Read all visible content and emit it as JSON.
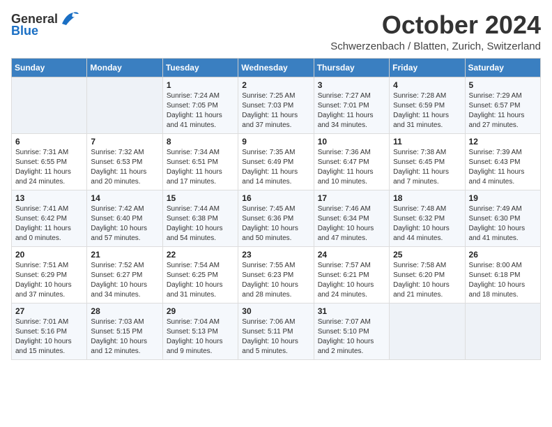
{
  "header": {
    "logo_general": "General",
    "logo_blue": "Blue",
    "month_title": "October 2024",
    "subtitle": "Schwerzenbach / Blatten, Zurich, Switzerland"
  },
  "days_of_week": [
    "Sunday",
    "Monday",
    "Tuesday",
    "Wednesday",
    "Thursday",
    "Friday",
    "Saturday"
  ],
  "weeks": [
    [
      {
        "day": "",
        "info": ""
      },
      {
        "day": "",
        "info": ""
      },
      {
        "day": "1",
        "info": "Sunrise: 7:24 AM\nSunset: 7:05 PM\nDaylight: 11 hours and 41 minutes."
      },
      {
        "day": "2",
        "info": "Sunrise: 7:25 AM\nSunset: 7:03 PM\nDaylight: 11 hours and 37 minutes."
      },
      {
        "day": "3",
        "info": "Sunrise: 7:27 AM\nSunset: 7:01 PM\nDaylight: 11 hours and 34 minutes."
      },
      {
        "day": "4",
        "info": "Sunrise: 7:28 AM\nSunset: 6:59 PM\nDaylight: 11 hours and 31 minutes."
      },
      {
        "day": "5",
        "info": "Sunrise: 7:29 AM\nSunset: 6:57 PM\nDaylight: 11 hours and 27 minutes."
      }
    ],
    [
      {
        "day": "6",
        "info": "Sunrise: 7:31 AM\nSunset: 6:55 PM\nDaylight: 11 hours and 24 minutes."
      },
      {
        "day": "7",
        "info": "Sunrise: 7:32 AM\nSunset: 6:53 PM\nDaylight: 11 hours and 20 minutes."
      },
      {
        "day": "8",
        "info": "Sunrise: 7:34 AM\nSunset: 6:51 PM\nDaylight: 11 hours and 17 minutes."
      },
      {
        "day": "9",
        "info": "Sunrise: 7:35 AM\nSunset: 6:49 PM\nDaylight: 11 hours and 14 minutes."
      },
      {
        "day": "10",
        "info": "Sunrise: 7:36 AM\nSunset: 6:47 PM\nDaylight: 11 hours and 10 minutes."
      },
      {
        "day": "11",
        "info": "Sunrise: 7:38 AM\nSunset: 6:45 PM\nDaylight: 11 hours and 7 minutes."
      },
      {
        "day": "12",
        "info": "Sunrise: 7:39 AM\nSunset: 6:43 PM\nDaylight: 11 hours and 4 minutes."
      }
    ],
    [
      {
        "day": "13",
        "info": "Sunrise: 7:41 AM\nSunset: 6:42 PM\nDaylight: 11 hours and 0 minutes."
      },
      {
        "day": "14",
        "info": "Sunrise: 7:42 AM\nSunset: 6:40 PM\nDaylight: 10 hours and 57 minutes."
      },
      {
        "day": "15",
        "info": "Sunrise: 7:44 AM\nSunset: 6:38 PM\nDaylight: 10 hours and 54 minutes."
      },
      {
        "day": "16",
        "info": "Sunrise: 7:45 AM\nSunset: 6:36 PM\nDaylight: 10 hours and 50 minutes."
      },
      {
        "day": "17",
        "info": "Sunrise: 7:46 AM\nSunset: 6:34 PM\nDaylight: 10 hours and 47 minutes."
      },
      {
        "day": "18",
        "info": "Sunrise: 7:48 AM\nSunset: 6:32 PM\nDaylight: 10 hours and 44 minutes."
      },
      {
        "day": "19",
        "info": "Sunrise: 7:49 AM\nSunset: 6:30 PM\nDaylight: 10 hours and 41 minutes."
      }
    ],
    [
      {
        "day": "20",
        "info": "Sunrise: 7:51 AM\nSunset: 6:29 PM\nDaylight: 10 hours and 37 minutes."
      },
      {
        "day": "21",
        "info": "Sunrise: 7:52 AM\nSunset: 6:27 PM\nDaylight: 10 hours and 34 minutes."
      },
      {
        "day": "22",
        "info": "Sunrise: 7:54 AM\nSunset: 6:25 PM\nDaylight: 10 hours and 31 minutes."
      },
      {
        "day": "23",
        "info": "Sunrise: 7:55 AM\nSunset: 6:23 PM\nDaylight: 10 hours and 28 minutes."
      },
      {
        "day": "24",
        "info": "Sunrise: 7:57 AM\nSunset: 6:21 PM\nDaylight: 10 hours and 24 minutes."
      },
      {
        "day": "25",
        "info": "Sunrise: 7:58 AM\nSunset: 6:20 PM\nDaylight: 10 hours and 21 minutes."
      },
      {
        "day": "26",
        "info": "Sunrise: 8:00 AM\nSunset: 6:18 PM\nDaylight: 10 hours and 18 minutes."
      }
    ],
    [
      {
        "day": "27",
        "info": "Sunrise: 7:01 AM\nSunset: 5:16 PM\nDaylight: 10 hours and 15 minutes."
      },
      {
        "day": "28",
        "info": "Sunrise: 7:03 AM\nSunset: 5:15 PM\nDaylight: 10 hours and 12 minutes."
      },
      {
        "day": "29",
        "info": "Sunrise: 7:04 AM\nSunset: 5:13 PM\nDaylight: 10 hours and 9 minutes."
      },
      {
        "day": "30",
        "info": "Sunrise: 7:06 AM\nSunset: 5:11 PM\nDaylight: 10 hours and 5 minutes."
      },
      {
        "day": "31",
        "info": "Sunrise: 7:07 AM\nSunset: 5:10 PM\nDaylight: 10 hours and 2 minutes."
      },
      {
        "day": "",
        "info": ""
      },
      {
        "day": "",
        "info": ""
      }
    ]
  ]
}
